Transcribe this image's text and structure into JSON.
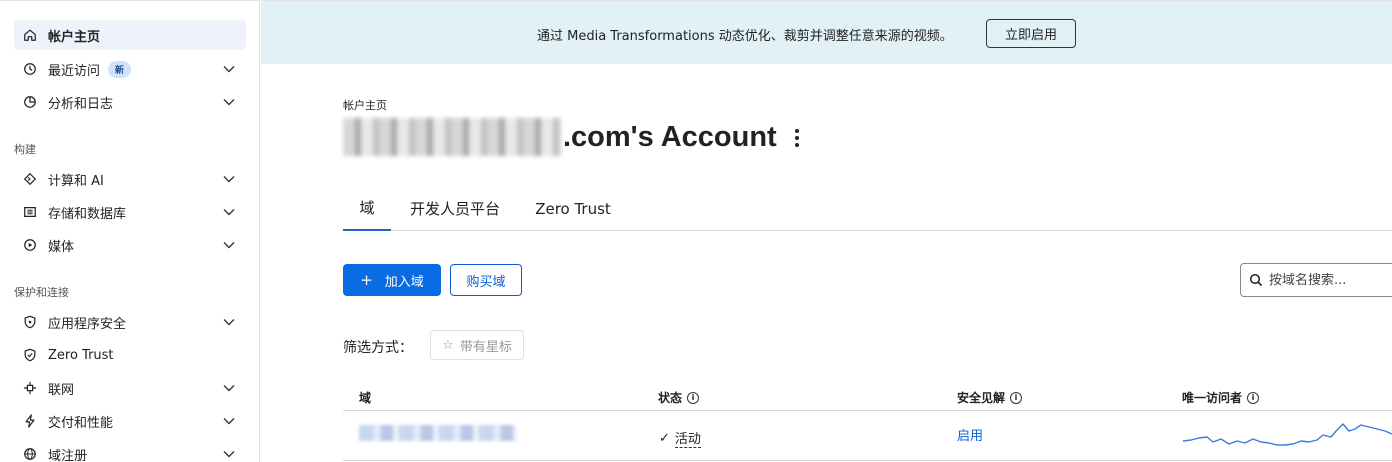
{
  "sidebar": {
    "items": [
      {
        "label": "帐户主页",
        "icon": "home-icon",
        "active": true,
        "chevron": false
      },
      {
        "label": "最近访问",
        "icon": "clock-icon",
        "badge": "新",
        "chevron": true
      },
      {
        "label": "分析和日志",
        "icon": "chart-pie-icon",
        "chevron": true
      }
    ],
    "section_build": "构建",
    "build_items": [
      {
        "label": "计算和 AI",
        "icon": "code-diamond-icon",
        "chevron": true
      },
      {
        "label": "存储和数据库",
        "icon": "storage-icon",
        "chevron": true
      },
      {
        "label": "媒体",
        "icon": "play-circle-icon",
        "chevron": true
      }
    ],
    "section_protect": "保护和连接",
    "protect_items": [
      {
        "label": "应用程序安全",
        "icon": "shield-icon",
        "chevron": true
      },
      {
        "label": "Zero Trust",
        "icon": "zero-trust-icon",
        "chevron": false
      },
      {
        "label": "联网",
        "icon": "network-icon",
        "chevron": true
      },
      {
        "label": "交付和性能",
        "icon": "bolt-icon",
        "chevron": true
      },
      {
        "label": "域注册",
        "icon": "globe-icon",
        "chevron": true
      }
    ]
  },
  "banner": {
    "text": "通过 Media Transformations 动态优化、裁剪并调整任意来源的视频。",
    "button": "立即启用"
  },
  "header": {
    "breadcrumb": "帐户主页",
    "title_suffix": ".com's Account"
  },
  "tabs": [
    {
      "label": "域",
      "active": true
    },
    {
      "label": "开发人员平台",
      "active": false
    },
    {
      "label": "Zero Trust",
      "active": false
    }
  ],
  "actions": {
    "add_domain": "加入域",
    "buy_domain": "购买域",
    "search_placeholder": "按域名搜索..."
  },
  "filter": {
    "label": "筛选方式：",
    "starred": "带有星标"
  },
  "table": {
    "columns": [
      "域",
      "状态",
      "安全见解",
      "唯一访问者"
    ],
    "rows": [
      {
        "status": "活动",
        "insight": "启用"
      }
    ]
  },
  "colors": {
    "primary": "#0b6be3",
    "banner_bg": "#e2f1f6",
    "active_nav_bg": "#eef3fb",
    "link": "#0b5ed7",
    "sparkline": "#3b7ddd"
  }
}
